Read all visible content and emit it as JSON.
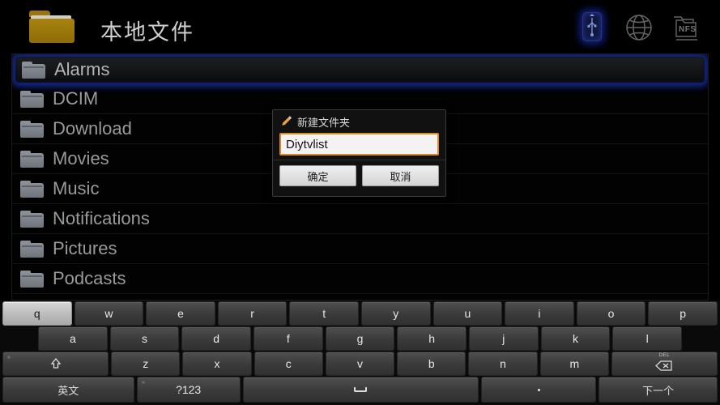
{
  "header": {
    "title": "本地文件",
    "folder_icon": "folder-icon",
    "icons": [
      {
        "name": "usb-device-icon",
        "label": "USB"
      },
      {
        "name": "network-globe-icon",
        "label": ""
      },
      {
        "name": "nfs-folder-icon",
        "label": "NFS"
      }
    ]
  },
  "file_list": {
    "items": [
      {
        "name": "Alarms",
        "selected": true
      },
      {
        "name": "DCIM",
        "selected": false
      },
      {
        "name": "Download",
        "selected": false
      },
      {
        "name": "Movies",
        "selected": false
      },
      {
        "name": "Music",
        "selected": false
      },
      {
        "name": "Notifications",
        "selected": false
      },
      {
        "name": "Pictures",
        "selected": false
      },
      {
        "name": "Podcasts",
        "selected": false
      }
    ]
  },
  "dialog": {
    "title": "新建文件夹",
    "icon": "pencil-icon",
    "input_value": "Diytvlist",
    "input_placeholder": "",
    "confirm_label": "确定",
    "cancel_label": "取消",
    "focus_color": "#d88a2a"
  },
  "keyboard": {
    "row1": [
      {
        "label": "q",
        "pressed": true
      },
      {
        "label": "w",
        "pressed": false
      },
      {
        "label": "e",
        "pressed": false
      },
      {
        "label": "r",
        "pressed": false
      },
      {
        "label": "t",
        "pressed": false
      },
      {
        "label": "y",
        "pressed": false
      },
      {
        "label": "u",
        "pressed": false
      },
      {
        "label": "i",
        "pressed": false
      },
      {
        "label": "o",
        "pressed": false
      },
      {
        "label": "p",
        "pressed": false
      }
    ],
    "row2": [
      {
        "label": "a"
      },
      {
        "label": "s"
      },
      {
        "label": "d"
      },
      {
        "label": "f"
      },
      {
        "label": "g"
      },
      {
        "label": "h"
      },
      {
        "label": "j"
      },
      {
        "label": "k"
      },
      {
        "label": "l"
      }
    ],
    "row3": [
      {
        "label": "",
        "key": "shift",
        "icon": "shift-arrow-icon"
      },
      {
        "label": "z"
      },
      {
        "label": "x"
      },
      {
        "label": "c"
      },
      {
        "label": "v"
      },
      {
        "label": "b"
      },
      {
        "label": "n"
      },
      {
        "label": "m"
      },
      {
        "label": "DEL",
        "key": "delete",
        "icon": "backspace-icon"
      }
    ],
    "row4": [
      {
        "label": "英文",
        "key": "language"
      },
      {
        "label": "?123",
        "key": "symbols"
      },
      {
        "label": "",
        "key": "space",
        "icon": "space-icon"
      },
      {
        "label": "",
        "key": "period",
        "icon": "period-icon"
      },
      {
        "label": "下一个",
        "key": "next"
      }
    ]
  },
  "colors": {
    "background": "#000000",
    "folder_yellow": "#9d7a0d",
    "selection_glow": "#1a2fb0",
    "key_face": "#3a3a3a",
    "key_pressed": "#c7c7c7"
  }
}
